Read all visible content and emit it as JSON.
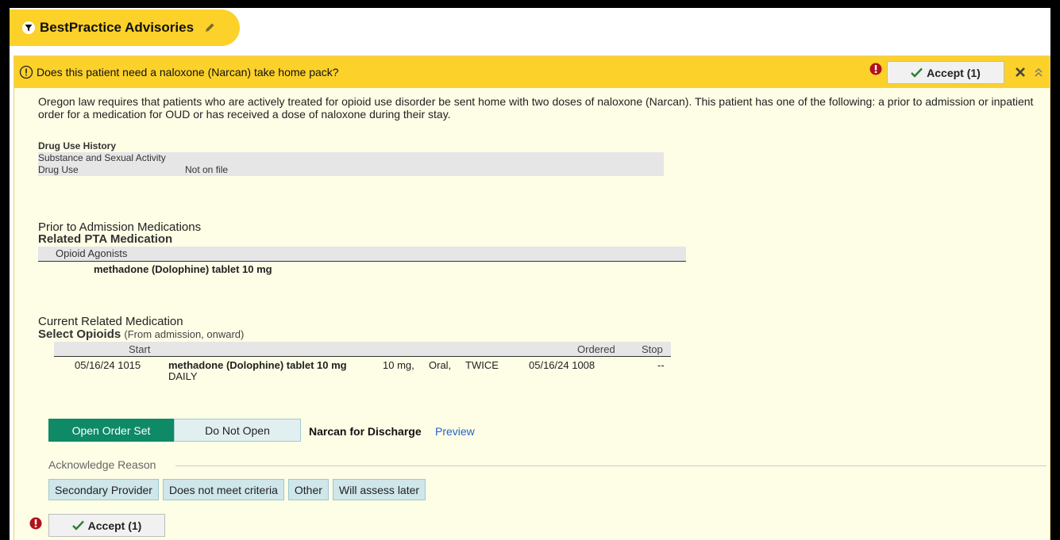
{
  "header": {
    "title": "BestPractice Advisories",
    "filter_icon": "filter-icon",
    "edit_icon": "pencil-icon"
  },
  "advisory": {
    "question": "Does this patient need a naloxone (Narcan) take home pack?",
    "accept_label": "Accept (1)",
    "body": "Oregon law requires that patients who are actively treated for opioid use disorder be sent home with two doses of naloxone (Narcan). This patient has one of the following: a prior to admission or inpatient order for a medication for OUD or has received a dose of naloxone during their stay.",
    "colors": {
      "banner": "#fcd12a",
      "background": "#fefde6",
      "open_button": "#0f8a66",
      "link": "#2763c9",
      "alert": "#b0121b"
    }
  },
  "drug_history": {
    "title": "Drug Use History",
    "subtitle": "Substance and Sexual Activity",
    "rows": [
      {
        "label": "Drug Use",
        "value": "Not on file"
      }
    ]
  },
  "pta": {
    "section": "Prior to Admission Medications",
    "subheading": "Related PTA Medication",
    "group": "Opioid Agonists",
    "medication": "methadone (Dolophine) tablet 10 mg"
  },
  "current": {
    "section": "Current Related Medication",
    "subheading": "Select Opioids",
    "note": "(From admission, onward)",
    "columns": {
      "start": "Start",
      "ordered": "Ordered",
      "stop": "Stop"
    },
    "rows": [
      {
        "start": "05/16/24 1015",
        "med": "methadone (Dolophine) tablet 10 mg",
        "dose": "10 mg,",
        "route": "Oral,",
        "freq1": "TWICE",
        "freq2": "DAILY",
        "ordered": "05/16/24 1008",
        "stop": "--"
      }
    ]
  },
  "order_set": {
    "open_label": "Open Order Set",
    "do_not_label": "Do Not Open",
    "name": "Narcan for Discharge",
    "preview": "Preview"
  },
  "acknowledge": {
    "label": "Acknowledge Reason",
    "reasons": [
      "Secondary Provider",
      "Does not meet criteria",
      "Other",
      "Will assess later"
    ]
  },
  "footer": {
    "accept_label": "Accept (1)"
  }
}
